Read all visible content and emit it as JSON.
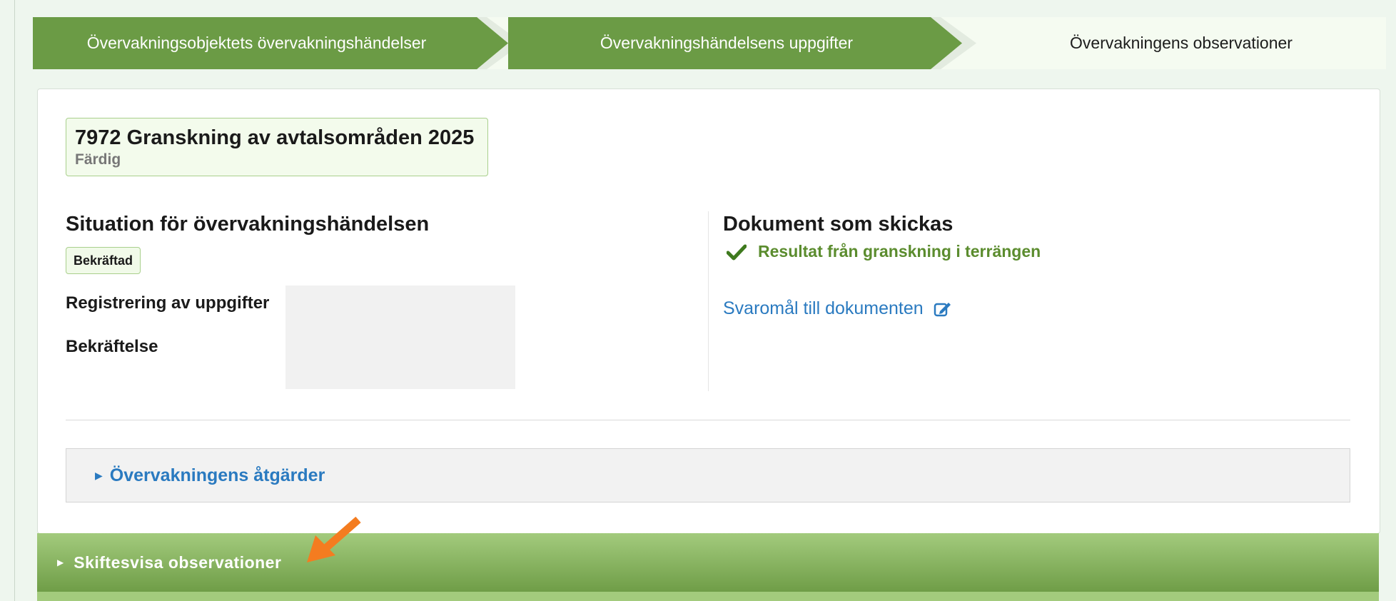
{
  "steps": [
    {
      "label": "Övervakningsobjektets övervakningshändelser",
      "state": "done"
    },
    {
      "label": "Övervakningshändelsens uppgifter",
      "state": "done"
    },
    {
      "label": "Övervakningens observationer",
      "state": "current"
    }
  ],
  "event": {
    "title": "7972 Granskning av avtalsområden 2025",
    "status": "Färdig"
  },
  "situation": {
    "heading": "Situation för övervakningshändelsen",
    "badge": "Bekräftad",
    "rows": [
      {
        "label": "Registrering av uppgifter"
      },
      {
        "label": "Bekräftelse"
      }
    ]
  },
  "documents": {
    "heading": "Dokument som skickas",
    "items": [
      {
        "label": "Resultat från granskning i terrängen",
        "icon": "check-icon"
      }
    ],
    "link": "Svaromål till dokumenten"
  },
  "actions_accordion": {
    "label": "Övervakningens åtgärder"
  },
  "observations_section": {
    "label": "Skiftesvisa observationer"
  },
  "colors": {
    "step_done": "#6b9b45",
    "accent_green": "#5b8c2e",
    "link_blue": "#2a7ac0",
    "annotation_arrow": "#f47c20"
  }
}
